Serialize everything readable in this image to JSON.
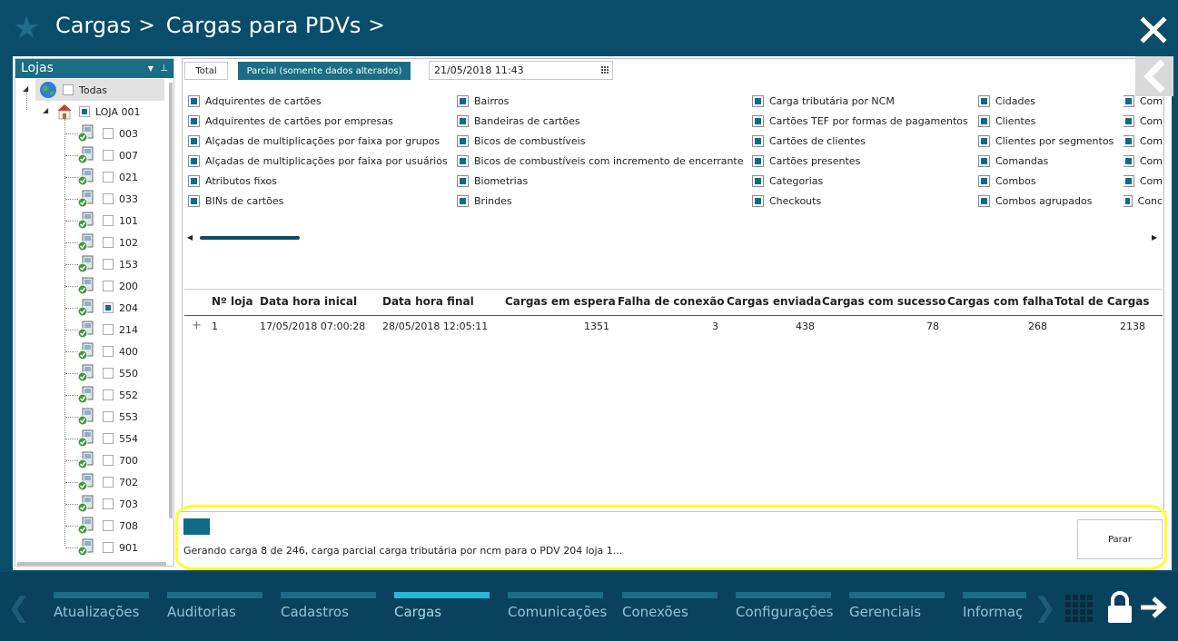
{
  "header": {
    "crumb1": "Cargas",
    "crumb2": "Cargas para PDVs",
    "sep": ">"
  },
  "tree": {
    "title": "Lojas",
    "root_label": "Todas",
    "store_label": "LOJA 001",
    "pdvs": [
      "003",
      "007",
      "021",
      "033",
      "101",
      "102",
      "153",
      "200",
      "204",
      "214",
      "400",
      "550",
      "552",
      "553",
      "554",
      "700",
      "702",
      "703",
      "708",
      "901"
    ],
    "checked_pdv": "204"
  },
  "toolbar": {
    "total_label": "Total",
    "parcial_label": "Parcial (somente dados alterados)",
    "date_value": "21/05/2018 11:43"
  },
  "categories": [
    [
      "Adquirentes de cartões",
      "Adquirentes de cartões por empresas",
      "Alçadas de multiplicações por faixa por grupos",
      "Alçadas de multiplicações por faixa por usuários",
      "Atributos fixos",
      "BINs de cartões"
    ],
    [
      "Bairros",
      "Bandeiras de cartões",
      "Bicos de combustíveis",
      "Bicos de combustíveis com incremento de encerrante",
      "Biometrias",
      "Brindes"
    ],
    [
      "Carga tributária por NCM",
      "Cartões TEF por formas de pagamentos",
      "Cartões de clientes",
      "Cartões presentes",
      "Categorias",
      "Checkouts"
    ],
    [
      "Cidades",
      "Clientes",
      "Clientes por segmentos",
      "Comandas",
      "Combos",
      "Combos agrupados"
    ],
    [
      "Com",
      "Com",
      "Com",
      "Com",
      "Com",
      "Conc"
    ]
  ],
  "grid": {
    "headers": [
      "Nº loja",
      "Data hora inical",
      "Data hora final",
      "Cargas em espera",
      "Falha de conexão",
      "Cargas enviada",
      "Cargas com sucesso",
      "Cargas com falha",
      "Total de Cargas"
    ],
    "row": {
      "expander": "+",
      "loja": "1",
      "inicio": "17/05/2018 07:00:28",
      "fim": "28/05/2018 12:05:11",
      "espera": "1351",
      "falha_conexao": "3",
      "enviada": "438",
      "sucesso": "78",
      "falha": "268",
      "total": "2138"
    }
  },
  "progress": {
    "status": "Gerando carga 8 de 246,  carga parcial  carga tributária por ncm para o PDV 204 loja 1...",
    "fraction": 0.0325,
    "stop_label": "Parar"
  },
  "nav": {
    "items": [
      "Atualizações",
      "Auditorias",
      "Cadastros",
      "Cargas",
      "Comunicações",
      "Conexões",
      "Configurações",
      "Gerenciais",
      "Informaç"
    ],
    "active": "Cargas"
  },
  "colors": {
    "background": "#0a4d6a",
    "accent": "#1a6d84",
    "active_tab": "#27b7d7",
    "highlight": "#ffff2a"
  }
}
